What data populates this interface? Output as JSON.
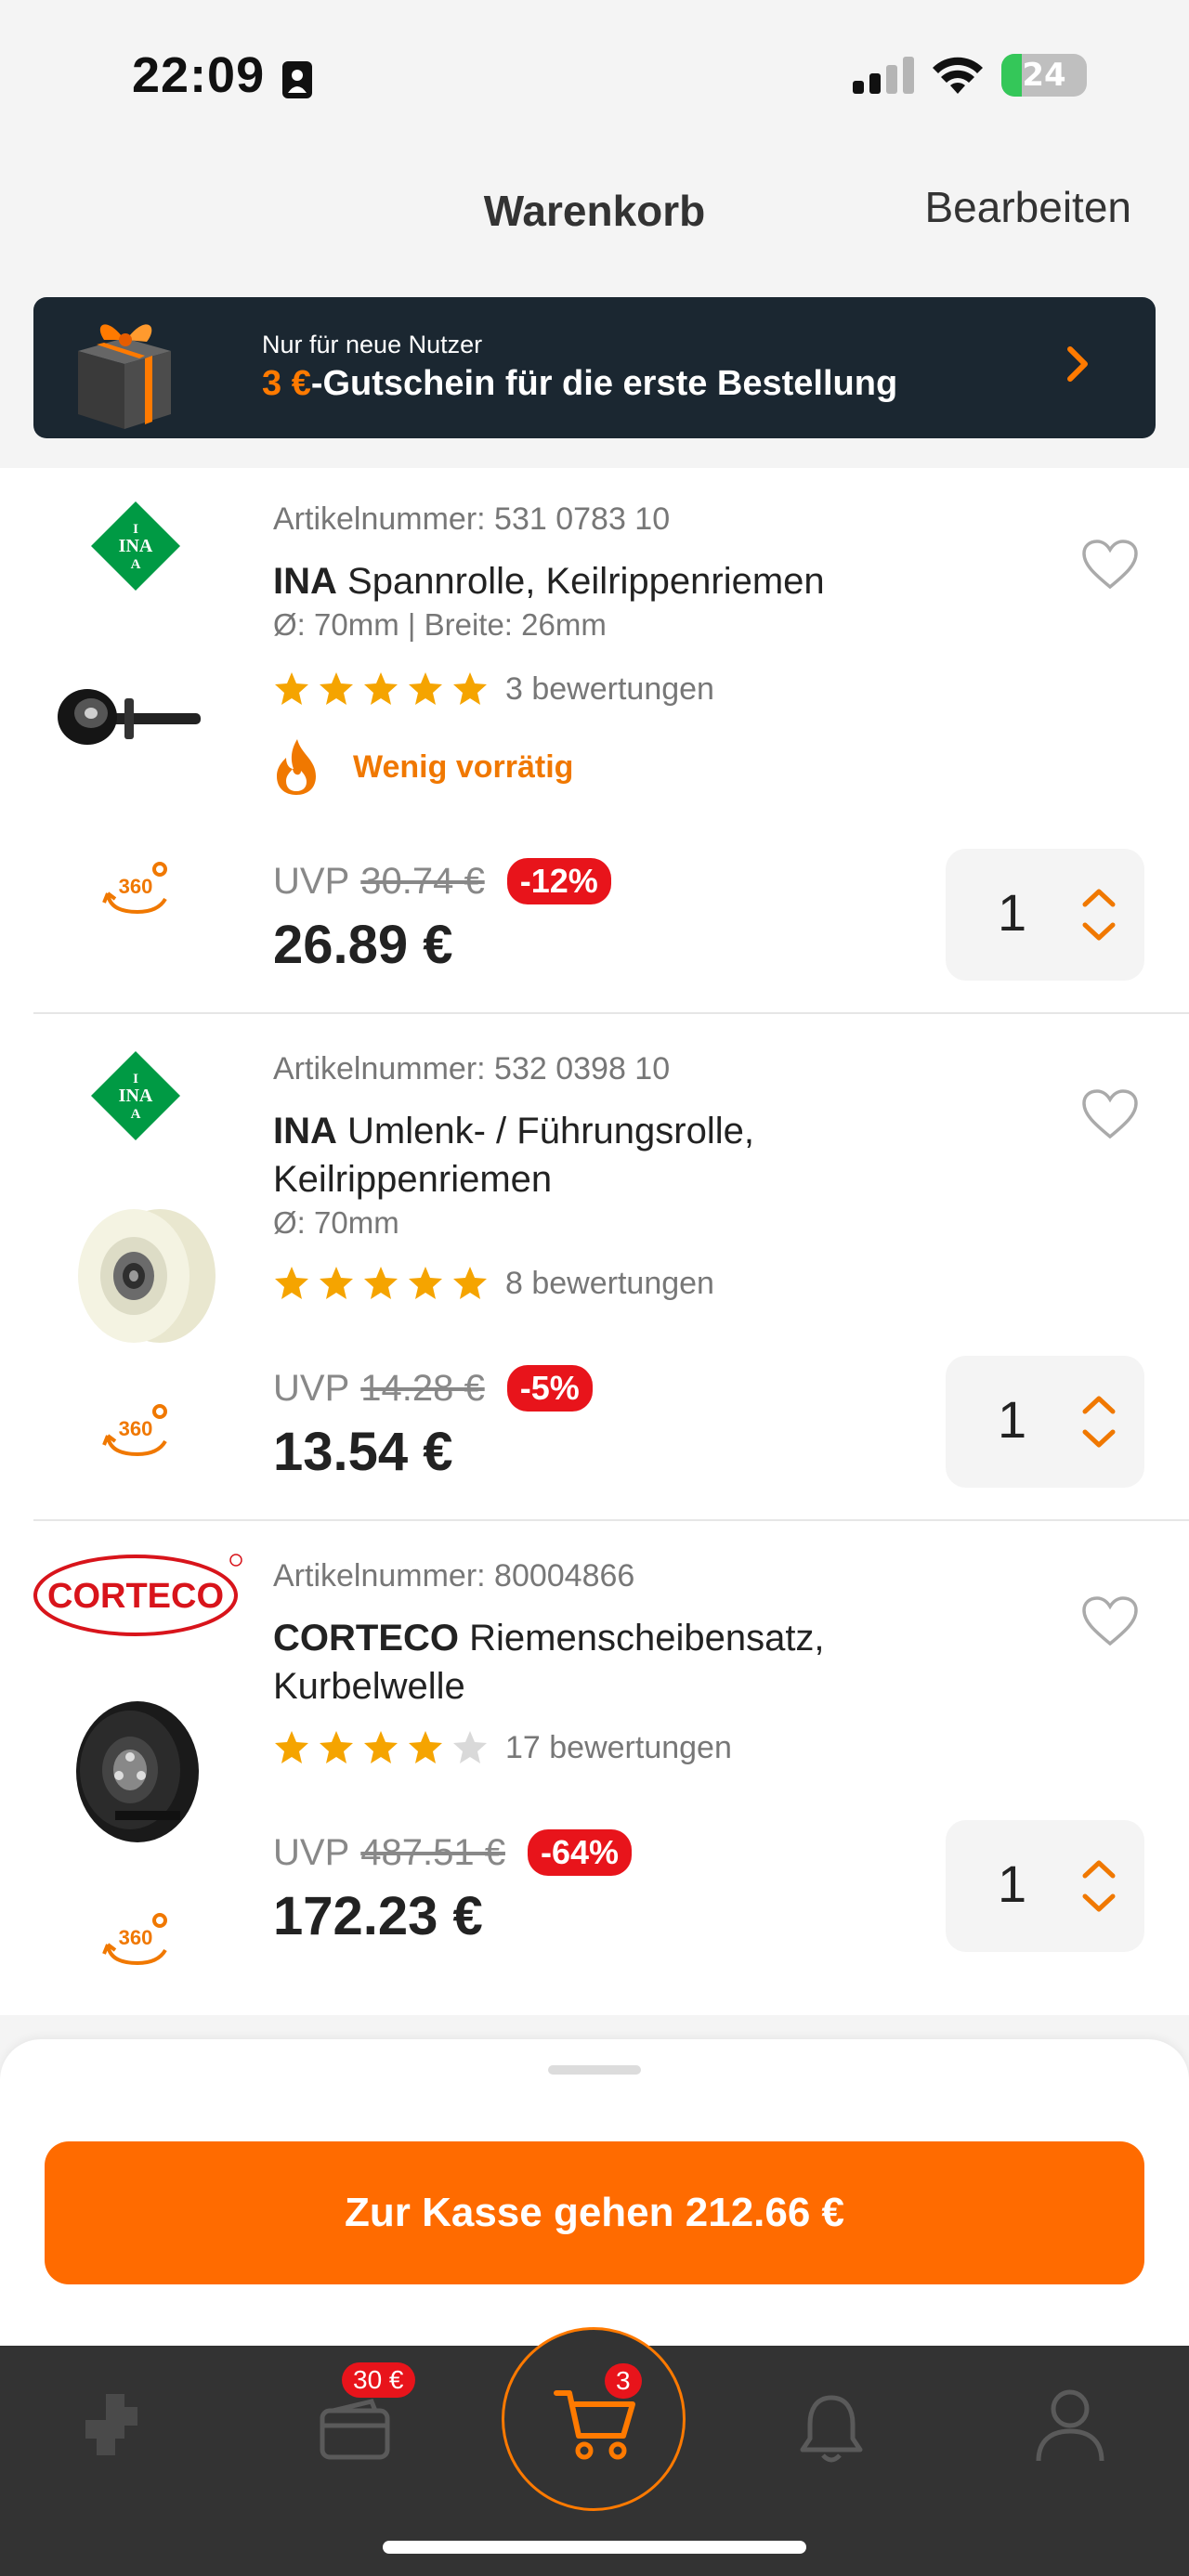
{
  "status_bar": {
    "time": "22:09",
    "battery": "24"
  },
  "nav": {
    "title": "Warenkorb",
    "edit": "Bearbeiten"
  },
  "promo": {
    "line1": "Nur für neue Nutzer",
    "amount": "3 €",
    "line2_rest": "-Gutschein für die erste Bestellung"
  },
  "items": [
    {
      "article": "Artikelnummer: 531 0783 10",
      "brand": "INA",
      "name_line1": "Spannrolle, Keilrippenriemen",
      "name_line2": "",
      "spec": "Ø: 70mm | Breite: 26mm",
      "stars": 5,
      "reviews": "3 bewertungen",
      "stock": "Wenig vorrätig",
      "uvp_label": "UVP",
      "uvp": "30.74 €",
      "discount": "-12%",
      "price": "26.89 €",
      "qty": "1"
    },
    {
      "article": "Artikelnummer: 532 0398 10",
      "brand": "INA",
      "name_line1": "Umlenk- / Führungsrolle,",
      "name_line2": "Keilrippenriemen",
      "spec": "Ø: 70mm",
      "stars": 5,
      "reviews": "8 bewertungen",
      "uvp_label": "UVP",
      "uvp": "14.28 €",
      "discount": "-5%",
      "price": "13.54 €",
      "qty": "1"
    },
    {
      "article": "Artikelnummer: 80004866",
      "brand": "CORTECO",
      "name_line1": "Riemenscheibensatz,",
      "name_line2": "Kurbelwelle",
      "stars": 4,
      "reviews": "17 bewertungen",
      "uvp_label": "UVP",
      "uvp": "487.51 €",
      "discount": "-64%",
      "price": "172.23 €",
      "qty": "1"
    }
  ],
  "logos": {
    "ina": "INA",
    "corteco": "CORTECO",
    "rot360": "360"
  },
  "checkout": {
    "label": "Zur Kasse gehen 212.66 €"
  },
  "tabbar": {
    "coupon_badge": "30 €",
    "cart_badge": "3"
  },
  "colors": {
    "accent": "#ff6b00",
    "sale": "#e8141b",
    "dark": "#333333",
    "promo_bg": "#1b2731",
    "ina_green": "#009a44",
    "star": "#f5a400"
  }
}
